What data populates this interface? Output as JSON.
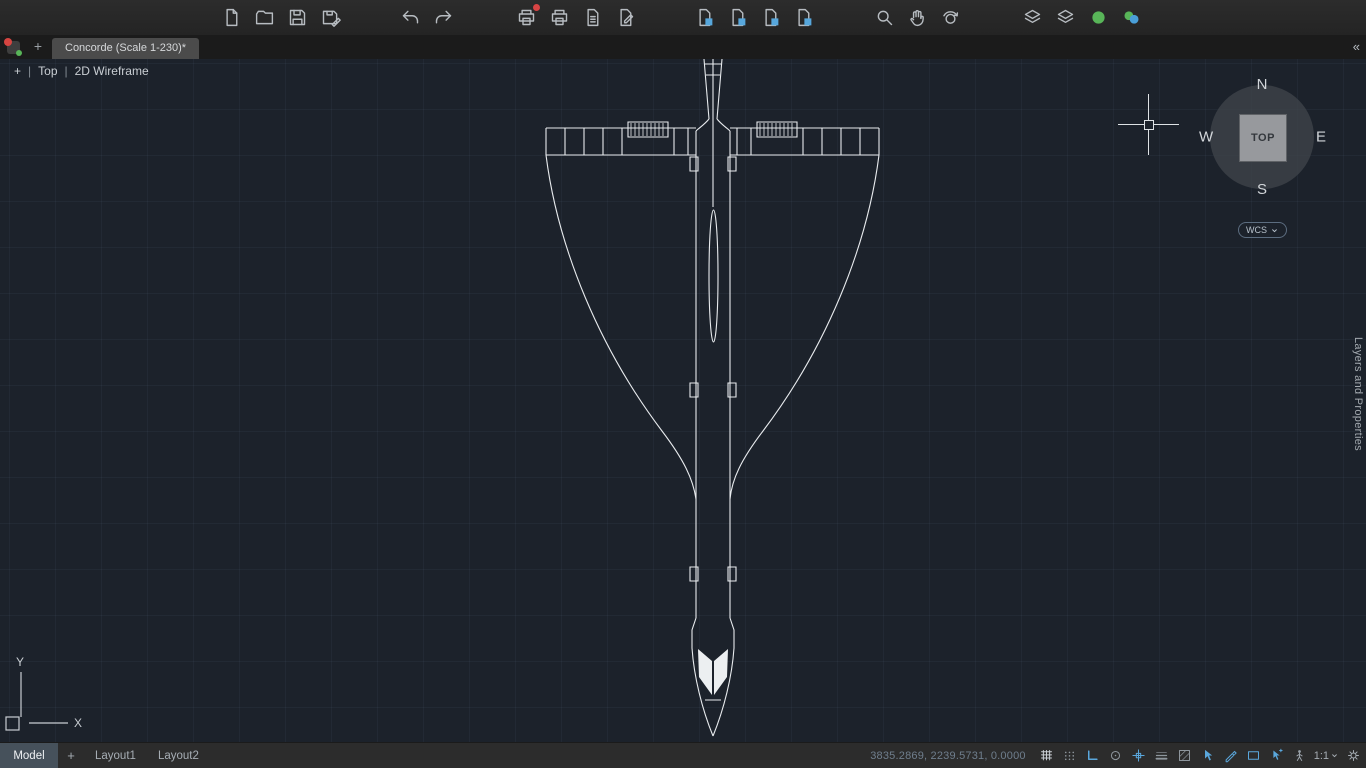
{
  "toolbar": {
    "groups": [
      {
        "name": "file",
        "icons": [
          {
            "name": "new-file-button",
            "icon": "page"
          },
          {
            "name": "open-button",
            "icon": "folder"
          },
          {
            "name": "save-button",
            "icon": "floppy"
          },
          {
            "name": "save-as-button",
            "icon": "floppy-pencil"
          }
        ]
      },
      {
        "name": "history",
        "icons": [
          {
            "name": "undo-button",
            "icon": "undo"
          },
          {
            "name": "redo-button",
            "icon": "redo"
          }
        ]
      },
      {
        "name": "output",
        "icons": [
          {
            "name": "plot-button",
            "icon": "printer",
            "badge": "#d84444"
          },
          {
            "name": "print-preview-button",
            "icon": "printer"
          },
          {
            "name": "page-setup-button",
            "icon": "page-lines"
          },
          {
            "name": "publish-button",
            "icon": "page-pencil"
          }
        ]
      },
      {
        "name": "insert",
        "icons": [
          {
            "name": "insert-block-button",
            "icon": "page-badge"
          },
          {
            "name": "attach-xref-button",
            "icon": "page-badge"
          },
          {
            "name": "attach-image-button",
            "icon": "page-badge"
          },
          {
            "name": "attach-pdf-button",
            "icon": "page-badge"
          }
        ]
      },
      {
        "name": "navigate",
        "icons": [
          {
            "name": "search-button",
            "icon": "magnifier"
          },
          {
            "name": "pan-button",
            "icon": "hand"
          },
          {
            "name": "orbit-button",
            "icon": "orbit"
          }
        ]
      },
      {
        "name": "layers",
        "icons": [
          {
            "name": "layer-properties-button",
            "icon": "layers"
          },
          {
            "name": "layer-states-button",
            "icon": "layers"
          },
          {
            "name": "layer-on-button",
            "icon": "circle-green"
          },
          {
            "name": "layer-settings-button",
            "icon": "circles"
          }
        ]
      }
    ]
  },
  "tabbar": {
    "new_tab_label": "+",
    "collapse_label": "«",
    "tabs": [
      {
        "label": "Concorde (Scale 1-230)*",
        "active": true
      }
    ]
  },
  "viewport_controls": {
    "menu_label": "+",
    "separator": "|",
    "view_label": "Top",
    "style_label": "2D Wireframe"
  },
  "viewcube": {
    "north": "N",
    "south": "S",
    "east": "E",
    "west": "W",
    "face": "TOP"
  },
  "wcs": {
    "label": "WCS"
  },
  "right_panel": {
    "label": "Layers and Properties"
  },
  "ucs": {
    "x_label": "X",
    "y_label": "Y"
  },
  "statusbar": {
    "model_tab": "Model",
    "add_layout_label": "+",
    "layout_tabs": [
      "Layout1",
      "Layout2"
    ],
    "coordinates": "3835.2869, 2239.5731, 0.0000",
    "annotation_scale": "1:1",
    "toggles": [
      {
        "name": "grid-display-toggle",
        "icon": "grid",
        "color": "#c9ced3",
        "active": true
      },
      {
        "name": "snap-mode-toggle",
        "icon": "dots",
        "color": "#8e969d",
        "active": false
      },
      {
        "name": "ortho-mode-toggle",
        "icon": "ortho",
        "color": "#5aa7dc",
        "active": true
      },
      {
        "name": "object-snap-toggle",
        "icon": "circle-o",
        "color": "#8e969d",
        "active": false
      },
      {
        "name": "snap-tracking-toggle",
        "icon": "cross-track",
        "color": "#5aa7dc",
        "active": true
      },
      {
        "name": "lineweight-toggle",
        "icon": "lines",
        "color": "#8e969d",
        "active": false
      },
      {
        "name": "transparency-toggle",
        "icon": "hatch",
        "color": "#8e969d",
        "active": false
      },
      {
        "name": "selection-cycling-toggle",
        "icon": "cursor",
        "color": "#5aa7dc",
        "active": true
      },
      {
        "name": "annotation-tools-toggle",
        "icon": "line-pencil",
        "color": "#5aa7dc",
        "active": true
      },
      {
        "name": "viewport-toggle",
        "icon": "rect",
        "color": "#5aa7dc",
        "active": true
      },
      {
        "name": "quick-properties-toggle",
        "icon": "cursor-star",
        "color": "#5aa7dc",
        "active": true
      },
      {
        "name": "annotation-visibility-toggle",
        "icon": "person",
        "color": "#9aa2aa",
        "active": false
      }
    ]
  }
}
